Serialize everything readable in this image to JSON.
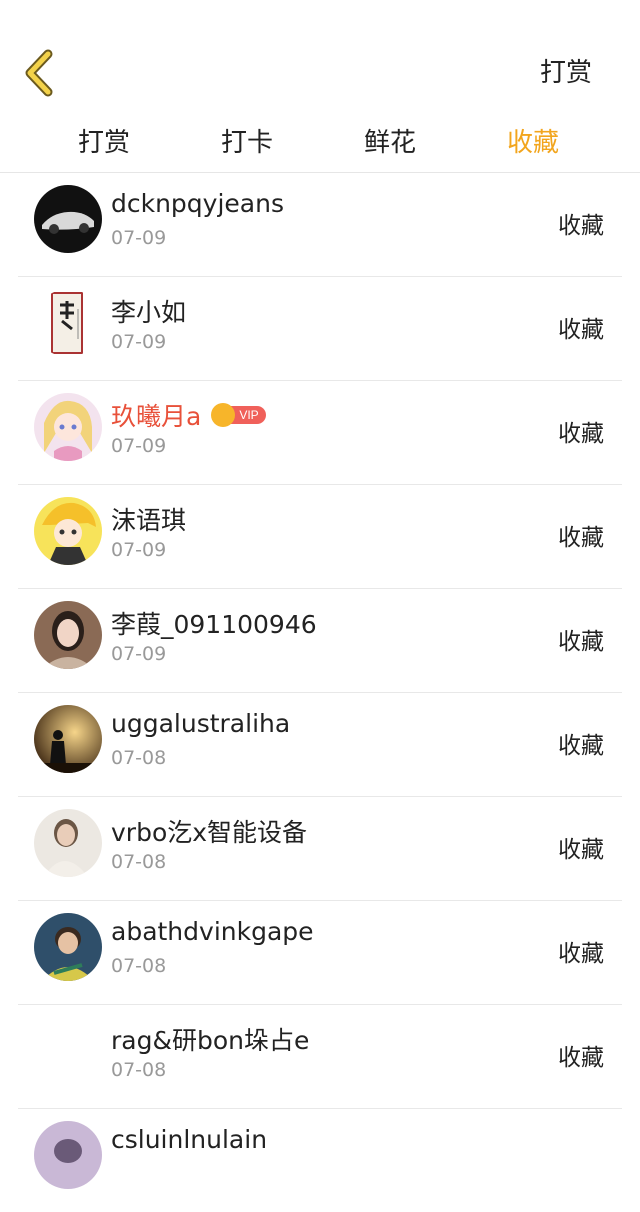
{
  "header": {
    "action_label": "打赏"
  },
  "tabs": [
    {
      "label": "打赏",
      "active": false
    },
    {
      "label": "打卡",
      "active": false
    },
    {
      "label": "鲜花",
      "active": false
    },
    {
      "label": "收藏",
      "active": true
    }
  ],
  "colors": {
    "accent": "#f2a51d",
    "vip_name": "#e8513a",
    "date": "#999999"
  },
  "list": [
    {
      "name": "dcknpqyjeans",
      "date": "07-09",
      "action": "收藏",
      "vip": false,
      "avatar": "car-avatar"
    },
    {
      "name": "李小如",
      "date": "07-09",
      "action": "收藏",
      "vip": false,
      "avatar": "calligraphy-scroll-avatar"
    },
    {
      "name": "玖曦月a",
      "date": "07-09",
      "action": "收藏",
      "vip": true,
      "vip_label": "VIP",
      "avatar": "anime-girl-avatar"
    },
    {
      "name": "沫语琪",
      "date": "07-09",
      "action": "收藏",
      "vip": false,
      "avatar": "anime-character-avatar"
    },
    {
      "name": "李葭_091100946",
      "date": "07-09",
      "action": "收藏",
      "vip": false,
      "avatar": "woman-photo-avatar"
    },
    {
      "name": "uggalustraliha",
      "date": "07-08",
      "action": "收藏",
      "vip": false,
      "avatar": "sunset-silhouette-avatar"
    },
    {
      "name": "vrbo汔x智能设备",
      "date": "07-08",
      "action": "收藏",
      "vip": false,
      "avatar": "woman-portrait-avatar"
    },
    {
      "name": "abathdvinkgape",
      "date": "07-08",
      "action": "收藏",
      "vip": false,
      "avatar": "boy-photo-avatar"
    },
    {
      "name": "rag&研bon垛占e",
      "date": "07-08",
      "action": "收藏",
      "vip": false,
      "avatar": "blank-avatar"
    },
    {
      "name": "csluinlnulain",
      "date": "",
      "action": "",
      "vip": false,
      "avatar": "partial-avatar"
    }
  ]
}
